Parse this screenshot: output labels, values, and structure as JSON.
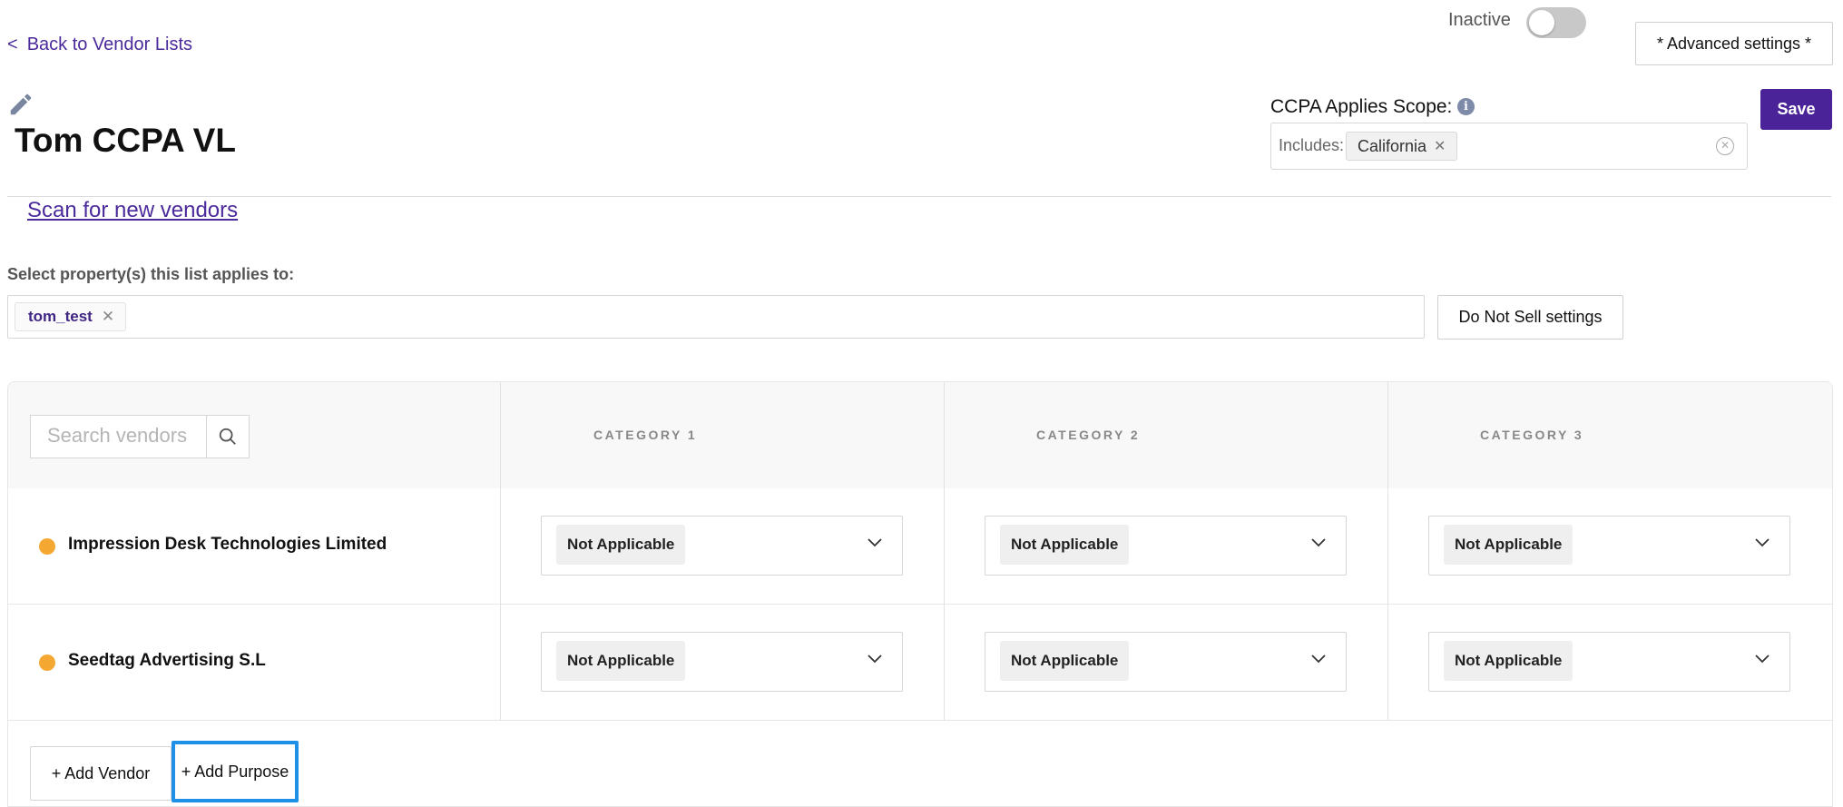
{
  "header": {
    "back_link": "Back to Vendor Lists",
    "back_chevron": "<",
    "status_label": "Inactive",
    "status_active": false,
    "advanced_settings": "* Advanced settings *",
    "save": "Save",
    "title": "Tom CCPA VL",
    "edit_icon": "pencil-icon"
  },
  "scope": {
    "label": "CCPA Applies Scope:",
    "info_icon": "i",
    "includes_label": "Includes:",
    "chips": [
      "California"
    ]
  },
  "scan_link": "Scan for new vendors",
  "properties": {
    "label": "Select property(s) this list applies to:",
    "chips": [
      "tom_test"
    ],
    "do_not_sell": "Do Not Sell settings"
  },
  "table": {
    "search_placeholder": "Search vendors",
    "categories": [
      "CATEGORY 1",
      "CATEGORY 2",
      "CATEGORY 3"
    ],
    "vendors": [
      {
        "name": "Impression Desk Technologies Limited",
        "status_color": "#f4a832",
        "values": [
          "Not Applicable",
          "Not Applicable",
          "Not Applicable"
        ]
      },
      {
        "name": "Seedtag Advertising S.L",
        "status_color": "#f4a832",
        "values": [
          "Not Applicable",
          "Not Applicable",
          "Not Applicable"
        ]
      }
    ],
    "add_vendor": "+ Add Vendor",
    "add_purpose": "+ Add Purpose"
  },
  "colors": {
    "accent": "#4b2399",
    "link": "#4b2a9b",
    "focus": "#1e90e8"
  }
}
